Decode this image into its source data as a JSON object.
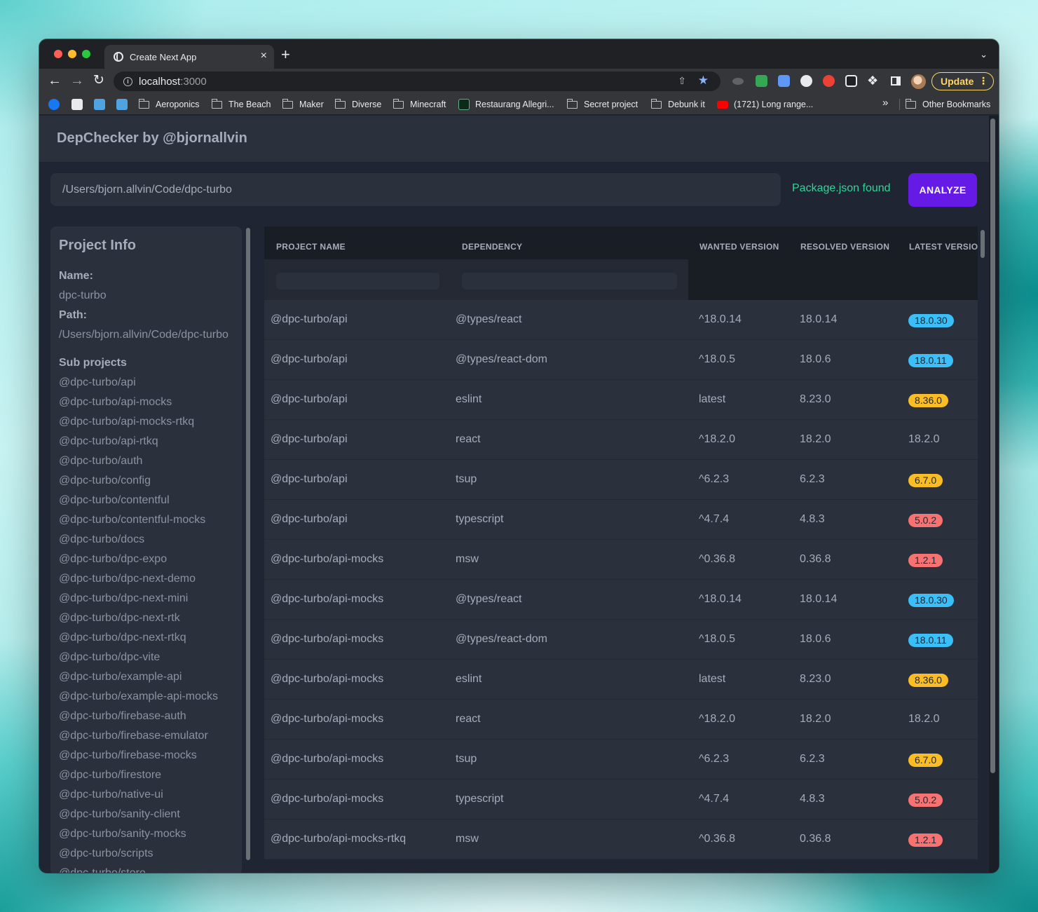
{
  "browser": {
    "tab_title": "Create Next App",
    "tab_close": "×",
    "new_tab": "+",
    "url_host": "localhost",
    "url_port": ":3000",
    "update_label": "Update",
    "bookmarks": [
      {
        "label": "Aeroponics",
        "type": "folder"
      },
      {
        "label": "The Beach",
        "type": "folder"
      },
      {
        "label": "Maker",
        "type": "folder"
      },
      {
        "label": "Diverse",
        "type": "folder"
      },
      {
        "label": "Minecraft",
        "type": "folder"
      },
      {
        "label": "Restaurang Allegri...",
        "type": "link"
      },
      {
        "label": "Secret project",
        "type": "folder"
      },
      {
        "label": "Debunk it",
        "type": "folder"
      },
      {
        "label": "(1721) Long range...",
        "type": "link"
      }
    ],
    "bookmarks_more": "»",
    "other_bookmarks": "Other Bookmarks"
  },
  "app": {
    "title": "DepChecker by @bjornallvin",
    "path_value": "/Users/bjorn.allvin/Code/dpc-turbo",
    "status": "Package.json found",
    "analyze_label": "ANALYZE"
  },
  "project_info": {
    "heading": "Project Info",
    "name_label": "Name:",
    "name_value": "dpc-turbo",
    "path_label": "Path:",
    "path_value": "/Users/bjorn.allvin/Code/dpc-turbo",
    "subprojects_label": "Sub projects",
    "subprojects": [
      "@dpc-turbo/api",
      "@dpc-turbo/api-mocks",
      "@dpc-turbo/api-mocks-rtkq",
      "@dpc-turbo/api-rtkq",
      "@dpc-turbo/auth",
      "@dpc-turbo/config",
      "@dpc-turbo/contentful",
      "@dpc-turbo/contentful-mocks",
      "@dpc-turbo/docs",
      "@dpc-turbo/dpc-expo",
      "@dpc-turbo/dpc-next-demo",
      "@dpc-turbo/dpc-next-mini",
      "@dpc-turbo/dpc-next-rtk",
      "@dpc-turbo/dpc-next-rtkq",
      "@dpc-turbo/dpc-vite",
      "@dpc-turbo/example-api",
      "@dpc-turbo/example-api-mocks",
      "@dpc-turbo/firebase-auth",
      "@dpc-turbo/firebase-emulator",
      "@dpc-turbo/firebase-mocks",
      "@dpc-turbo/firestore",
      "@dpc-turbo/native-ui",
      "@dpc-turbo/sanity-client",
      "@dpc-turbo/sanity-mocks",
      "@dpc-turbo/scripts",
      "@dpc-turbo/store"
    ]
  },
  "table": {
    "columns": [
      "PROJECT NAME",
      "DEPENDENCY",
      "WANTED VERSION",
      "RESOLVED VERSION",
      "LATEST VERSION"
    ],
    "badge_colors": {
      "info": "#3abff8",
      "warning": "#fbbd23",
      "error": "#f87272"
    },
    "rows": [
      {
        "project": "@dpc-turbo/api",
        "dependency": "@types/react",
        "wanted": "^18.0.14",
        "resolved": "18.0.14",
        "latest": "18.0.30",
        "status": "info"
      },
      {
        "project": "@dpc-turbo/api",
        "dependency": "@types/react-dom",
        "wanted": "^18.0.5",
        "resolved": "18.0.6",
        "latest": "18.0.11",
        "status": "info"
      },
      {
        "project": "@dpc-turbo/api",
        "dependency": "eslint",
        "wanted": "latest",
        "resolved": "8.23.0",
        "latest": "8.36.0",
        "status": "warning"
      },
      {
        "project": "@dpc-turbo/api",
        "dependency": "react",
        "wanted": "^18.2.0",
        "resolved": "18.2.0",
        "latest": "18.2.0",
        "status": "none"
      },
      {
        "project": "@dpc-turbo/api",
        "dependency": "tsup",
        "wanted": "^6.2.3",
        "resolved": "6.2.3",
        "latest": "6.7.0",
        "status": "warning"
      },
      {
        "project": "@dpc-turbo/api",
        "dependency": "typescript",
        "wanted": "^4.7.4",
        "resolved": "4.8.3",
        "latest": "5.0.2",
        "status": "error"
      },
      {
        "project": "@dpc-turbo/api-mocks",
        "dependency": "msw",
        "wanted": "^0.36.8",
        "resolved": "0.36.8",
        "latest": "1.2.1",
        "status": "error"
      },
      {
        "project": "@dpc-turbo/api-mocks",
        "dependency": "@types/react",
        "wanted": "^18.0.14",
        "resolved": "18.0.14",
        "latest": "18.0.30",
        "status": "info"
      },
      {
        "project": "@dpc-turbo/api-mocks",
        "dependency": "@types/react-dom",
        "wanted": "^18.0.5",
        "resolved": "18.0.6",
        "latest": "18.0.11",
        "status": "info"
      },
      {
        "project": "@dpc-turbo/api-mocks",
        "dependency": "eslint",
        "wanted": "latest",
        "resolved": "8.23.0",
        "latest": "8.36.0",
        "status": "warning"
      },
      {
        "project": "@dpc-turbo/api-mocks",
        "dependency": "react",
        "wanted": "^18.2.0",
        "resolved": "18.2.0",
        "latest": "18.2.0",
        "status": "none"
      },
      {
        "project": "@dpc-turbo/api-mocks",
        "dependency": "tsup",
        "wanted": "^6.2.3",
        "resolved": "6.2.3",
        "latest": "6.7.0",
        "status": "warning"
      },
      {
        "project": "@dpc-turbo/api-mocks",
        "dependency": "typescript",
        "wanted": "^4.7.4",
        "resolved": "4.8.3",
        "latest": "5.0.2",
        "status": "error"
      },
      {
        "project": "@dpc-turbo/api-mocks-rtkq",
        "dependency": "msw",
        "wanted": "^0.36.8",
        "resolved": "0.36.8",
        "latest": "1.2.1",
        "status": "error"
      }
    ]
  }
}
